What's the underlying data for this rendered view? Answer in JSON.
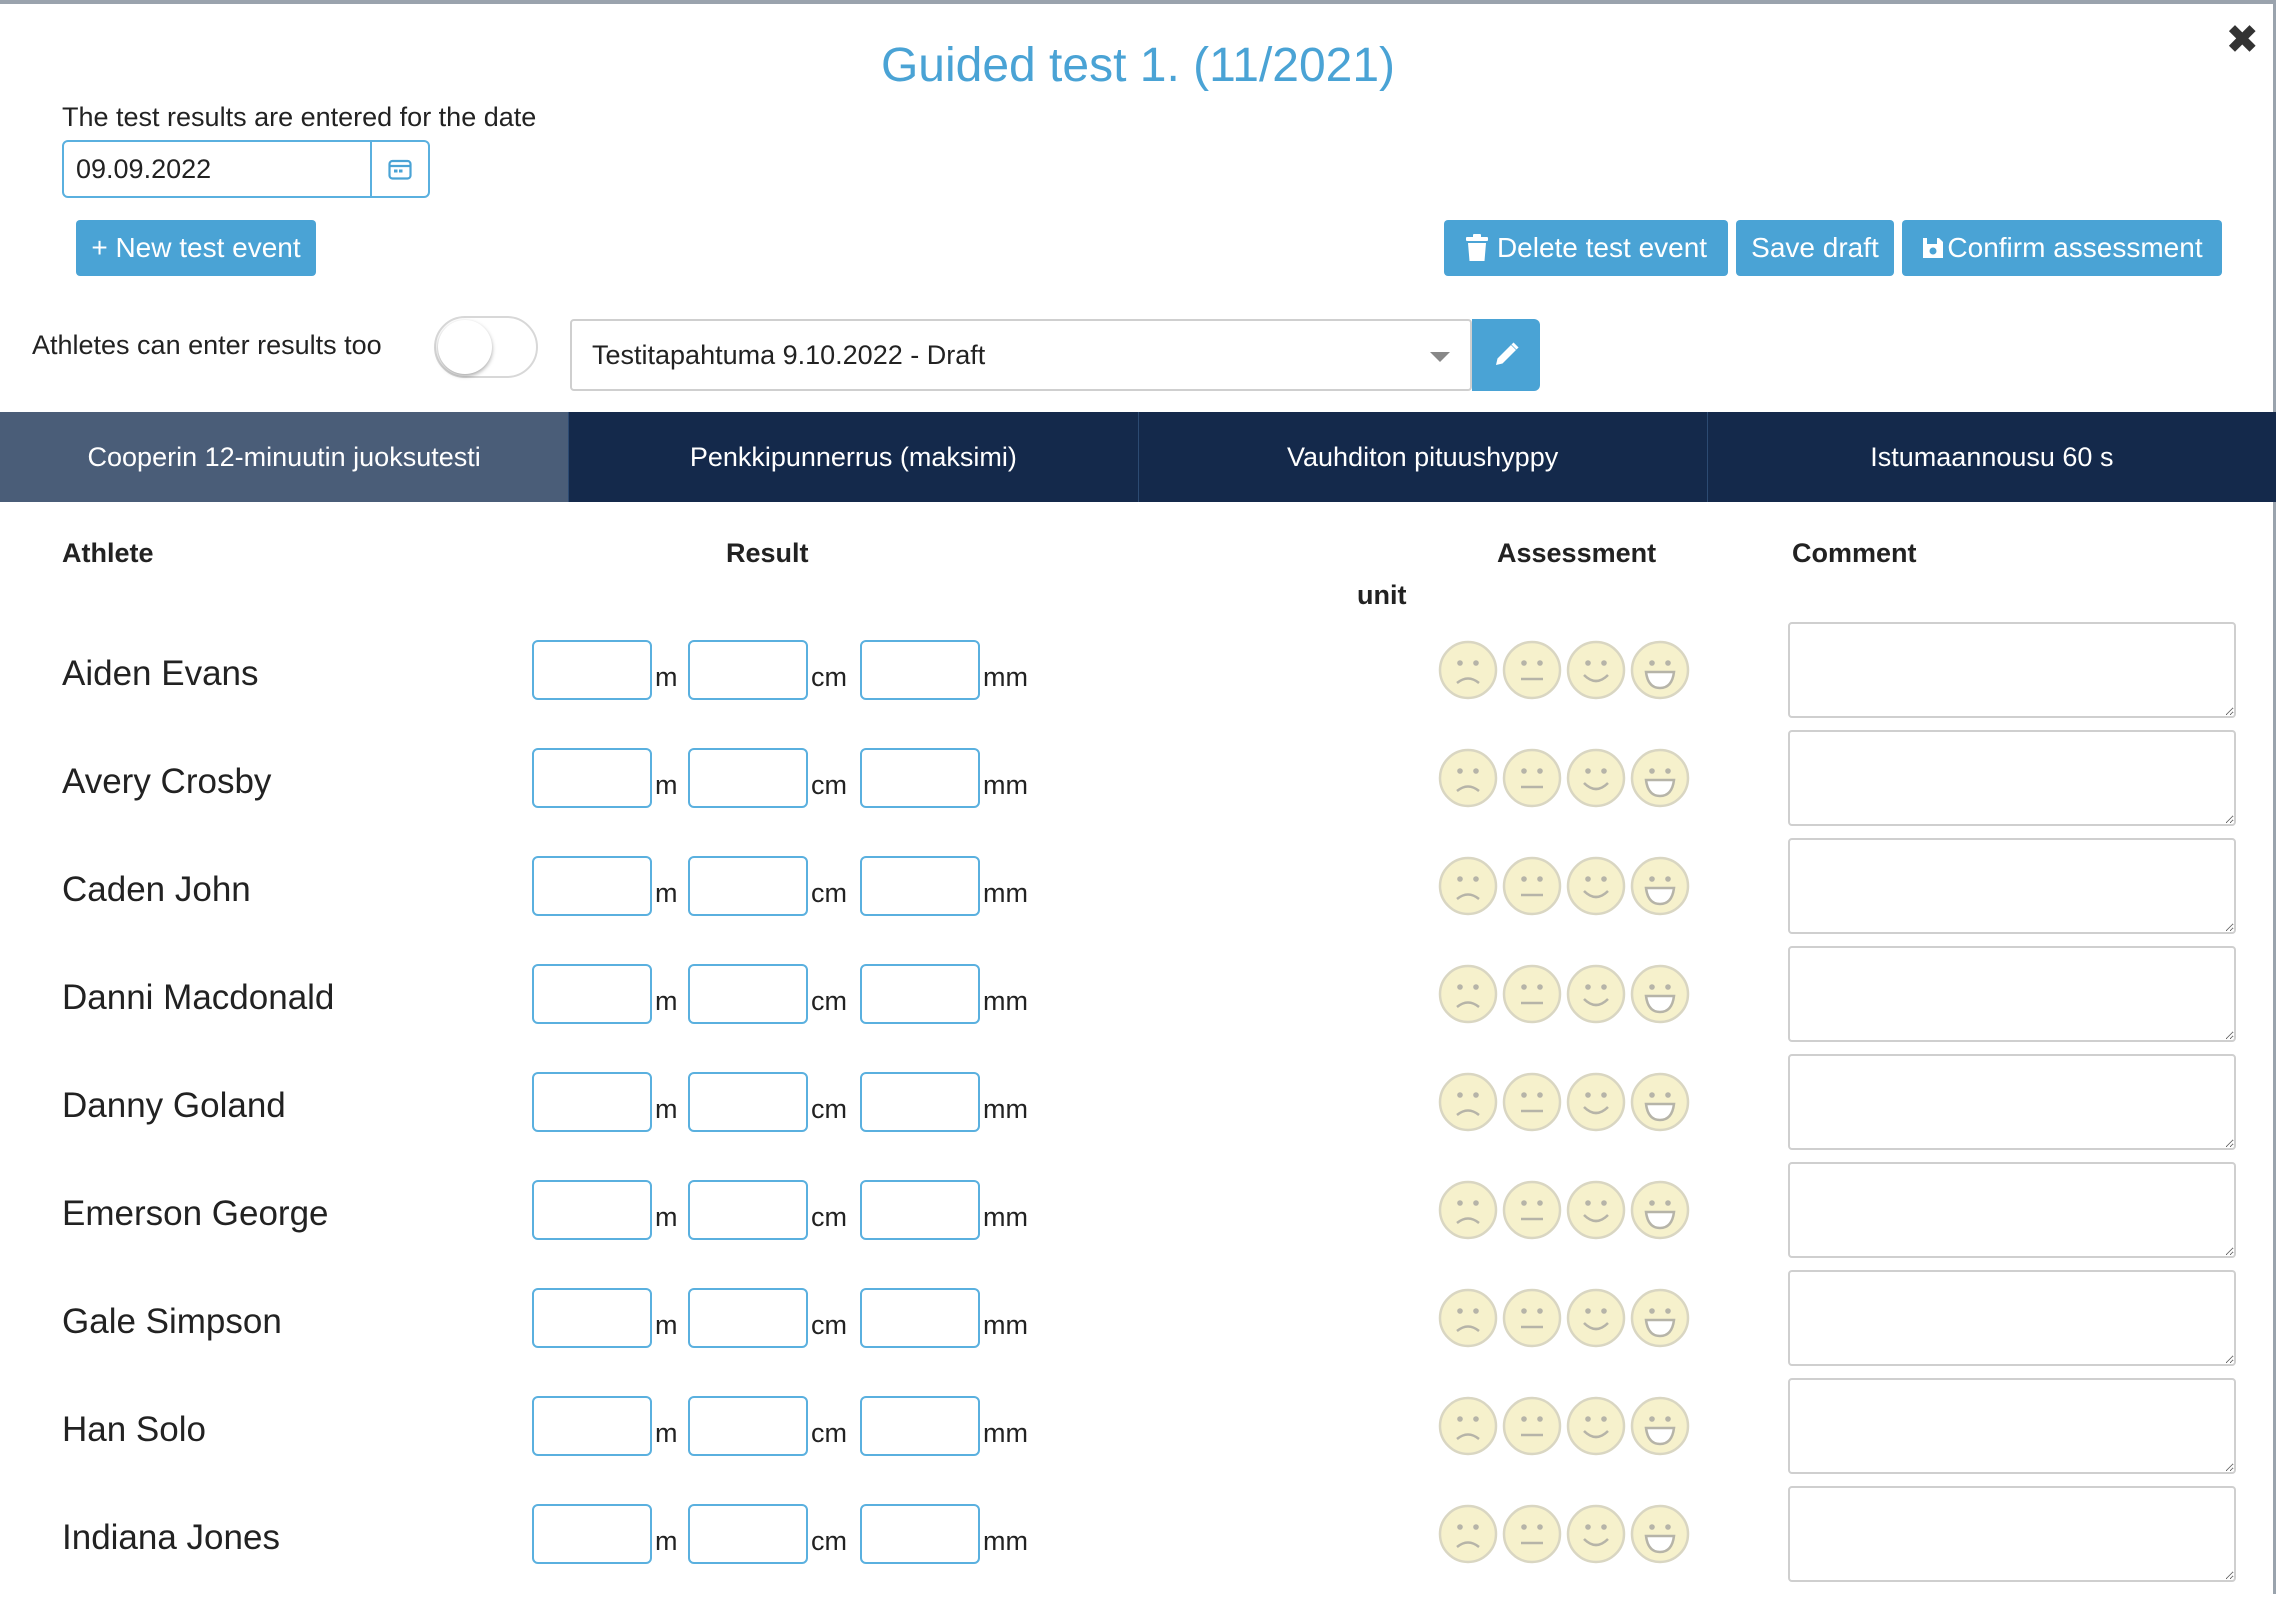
{
  "header": {
    "title": "Guided test 1. (11/2021)",
    "close_label": "✖"
  },
  "date": {
    "label": "The test results are entered for the date",
    "value": "09.09.2022"
  },
  "toolbar": {
    "new_event": "+ New test event",
    "delete_event": "Delete test event",
    "save_draft": "Save draft",
    "confirm": "Confirm assessment"
  },
  "settings": {
    "athletes_label": "Athletes can enter results too",
    "toggle_on": false,
    "event_selected": "Testitapahtuma 9.10.2022 - Draft"
  },
  "tabs": [
    {
      "label": "Cooperin 12-minuutin juoksutesti",
      "active": true
    },
    {
      "label": "Penkkipunnerrus (maksimi)",
      "active": false
    },
    {
      "label": "Vauhditon pituushyppy",
      "active": false
    },
    {
      "label": "Istumaannousu 60 s",
      "active": false
    }
  ],
  "table": {
    "headers": {
      "athlete": "Athlete",
      "result": "Result",
      "unit": "unit",
      "assessment": "Assessment",
      "comment": "Comment"
    },
    "units": [
      "m",
      "cm",
      "mm"
    ],
    "athletes": [
      "Aiden Evans",
      "Avery Crosby",
      "Caden John",
      "Danni Macdonald",
      "Danny Goland",
      "Emerson George",
      "Gale Simpson",
      "Han Solo",
      "Indiana Jones"
    ]
  },
  "colors": {
    "accent": "#4aa3d5",
    "tab_bg": "#14294b",
    "tab_active": "#4a5d78",
    "smiley_fill": "#f5efc4"
  },
  "icons": {
    "calendar": "calendar-icon",
    "trash": "trash-icon",
    "save": "floppy-icon",
    "edit": "pencil-icon",
    "assessments": [
      "sad-face-icon",
      "neutral-face-icon",
      "smile-face-icon",
      "laugh-face-icon"
    ]
  }
}
